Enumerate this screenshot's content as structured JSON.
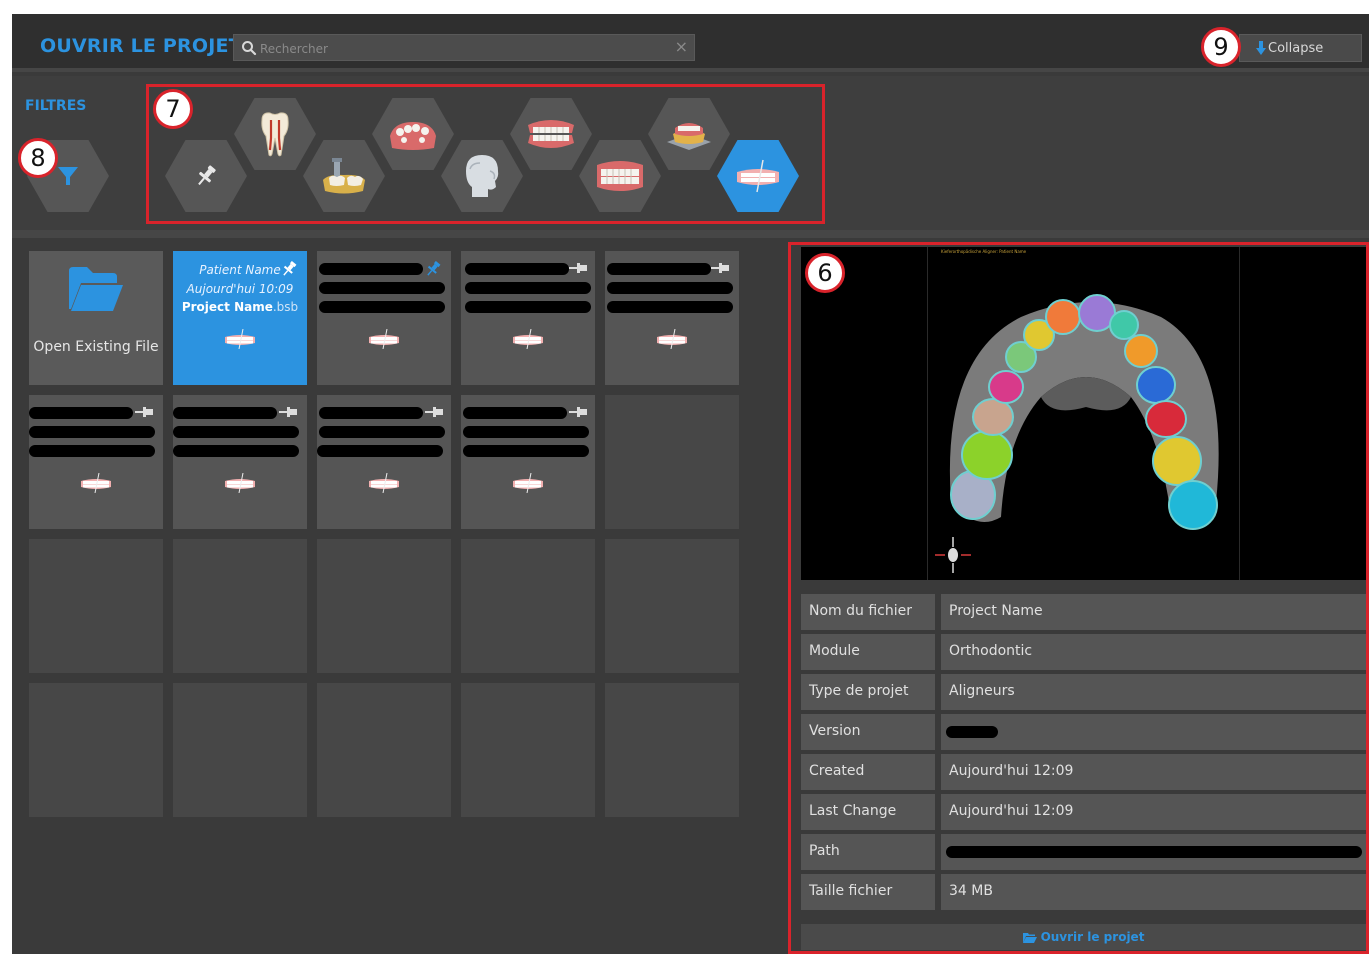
{
  "header": {
    "title": "OUVRIR LE PROJET",
    "search_placeholder": "Rechercher",
    "clear_label": "×",
    "collapse_label": "Collapse"
  },
  "filters": {
    "label": "FILTRES",
    "items": [
      {
        "name": "pinned",
        "icon": "pin-icon",
        "active": false
      },
      {
        "name": "endodontic",
        "icon": "tooth-root-icon",
        "active": false
      },
      {
        "name": "implant",
        "icon": "implant-icon",
        "active": false
      },
      {
        "name": "partial-denture",
        "icon": "partial-denture-icon",
        "active": false
      },
      {
        "name": "face-scan",
        "icon": "head-scan-icon",
        "active": false
      },
      {
        "name": "jaw",
        "icon": "jaw-icon",
        "active": false
      },
      {
        "name": "full-denture",
        "icon": "full-denture-icon",
        "active": false
      },
      {
        "name": "model-base",
        "icon": "model-base-icon",
        "active": false
      },
      {
        "name": "aligner",
        "icon": "aligner-icon",
        "active": true
      }
    ]
  },
  "grid": {
    "open_existing_label": "Open Existing File",
    "selected": {
      "patient": "Patient Name",
      "date": "Aujourd'hui 10:09",
      "project_name": "Project Name",
      "extension": ".bsb"
    }
  },
  "callouts": {
    "preview": "6",
    "filter_group": "7",
    "filter_toggle": "8",
    "collapse": "9"
  },
  "details": {
    "preview_caption": "Kieferorthopädische Aligner: Patient Name",
    "rows": [
      {
        "label": "Nom du fichier",
        "value": "Project Name"
      },
      {
        "label": "Module",
        "value": "Orthodontic"
      },
      {
        "label": "Type de projet",
        "value": "Aligneurs"
      },
      {
        "label": "Version",
        "value": ""
      },
      {
        "label": "Created",
        "value": "Aujourd'hui 12:09"
      },
      {
        "label": "Last Change",
        "value": "Aujourd'hui 12:09"
      },
      {
        "label": "Path",
        "value": ""
      },
      {
        "label": "Taille fichier",
        "value": "34 MB"
      }
    ],
    "open_button": "Ouvrir le projet"
  },
  "colors": {
    "accent": "#2c93e0",
    "annotation_red": "#d9232b",
    "background": "#3a3a3a"
  }
}
